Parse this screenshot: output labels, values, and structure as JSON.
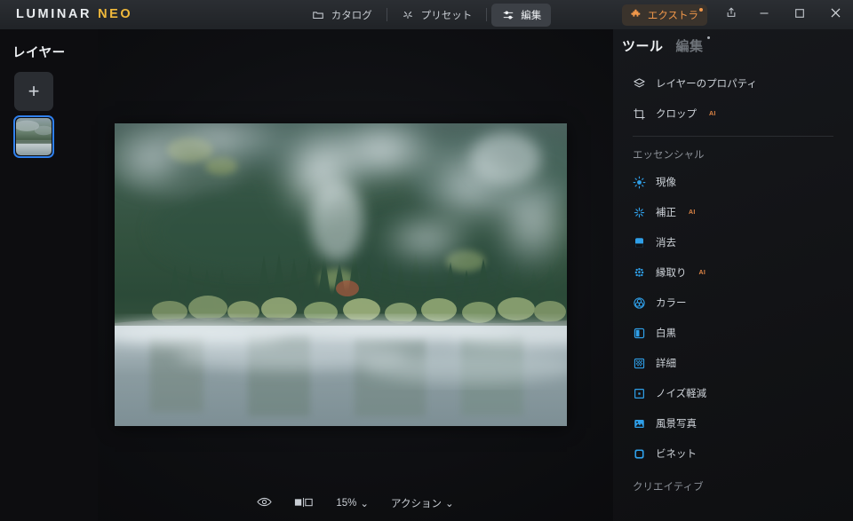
{
  "app": {
    "logo_primary": "LUMINAR",
    "logo_secondary": "NEO"
  },
  "topnav": {
    "items": [
      {
        "label": "カタログ",
        "icon": "folder-icon",
        "active": false
      },
      {
        "label": "プリセット",
        "icon": "sparkle-icon",
        "active": false
      },
      {
        "label": "編集",
        "icon": "sliders-icon",
        "active": true
      }
    ],
    "extras_label": "エクストラ",
    "extras_icon": "puzzle-icon",
    "extras_color": "#f0974a",
    "window_controls": [
      "share-icon",
      "minimize-icon",
      "maximize-icon",
      "close-icon"
    ]
  },
  "left_panel": {
    "title": "レイヤー",
    "add_button_label": "+",
    "layers": [
      {
        "name": "layer-thumbnail-1",
        "selected": true
      }
    ],
    "selection_color": "#2f80ed"
  },
  "canvas": {
    "bottom_bar": {
      "preview_icon": "eye-icon",
      "compare_icon": "compare-icon",
      "zoom_value": "15%",
      "zoom_caret": "⌄",
      "actions_label": "アクション",
      "actions_caret": "⌄"
    }
  },
  "right_panel": {
    "tabs": [
      {
        "label": "ツール",
        "active": true,
        "dot": false
      },
      {
        "label": "編集",
        "active": false,
        "dot": true
      }
    ],
    "top_tools": [
      {
        "label": "レイヤーのプロパティ",
        "icon": "layers-icon",
        "ai": ""
      },
      {
        "label": "クロップ",
        "icon": "crop-icon",
        "ai": "AI"
      }
    ],
    "sections": [
      {
        "label": "エッセンシャル",
        "items": [
          {
            "label": "現像",
            "icon": "develop-sun-icon",
            "ai": ""
          },
          {
            "label": "補正",
            "icon": "enhance-sparkle-icon",
            "ai": "AI"
          },
          {
            "label": "消去",
            "icon": "erase-icon",
            "ai": ""
          },
          {
            "label": "縁取り",
            "icon": "dots-grid-icon",
            "ai": "AI"
          },
          {
            "label": "カラー",
            "icon": "color-wheel-icon",
            "ai": ""
          },
          {
            "label": "白黒",
            "icon": "black-white-icon",
            "ai": ""
          },
          {
            "label": "詳細",
            "icon": "details-grid-icon",
            "ai": ""
          },
          {
            "label": "ノイズ軽減",
            "icon": "noise-square-icon",
            "ai": ""
          },
          {
            "label": "風景写真",
            "icon": "landscape-icon",
            "ai": ""
          },
          {
            "label": "ビネット",
            "icon": "vignette-icon",
            "ai": ""
          }
        ]
      },
      {
        "label": "クリエイティブ",
        "items": []
      }
    ],
    "icon_color": "#2f9fe8"
  }
}
